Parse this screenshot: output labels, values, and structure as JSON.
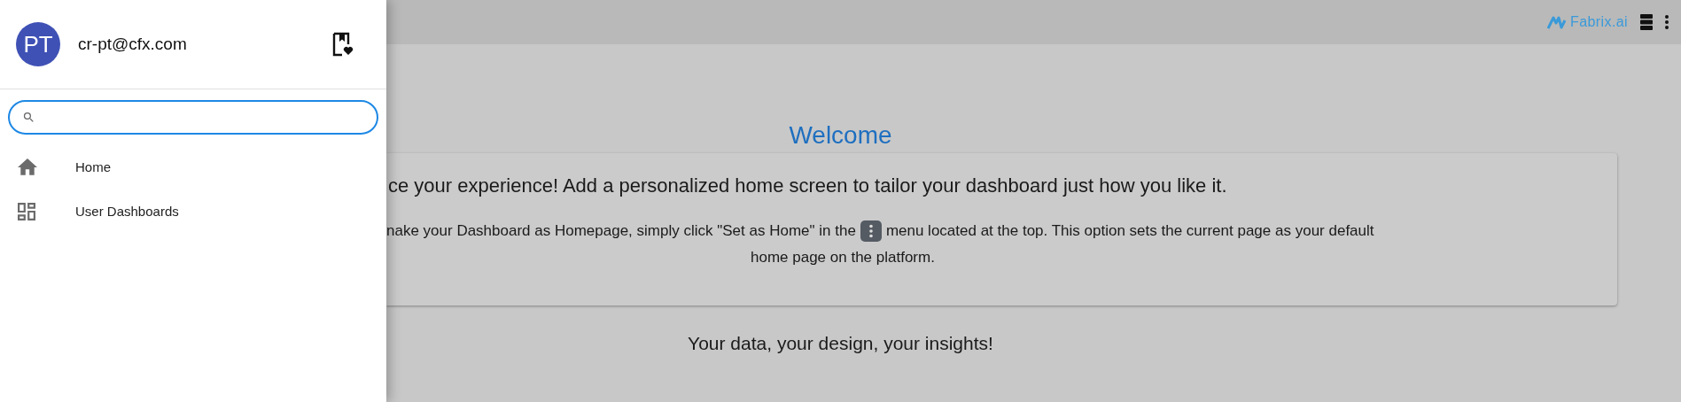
{
  "topbar": {
    "brand": "Fabrix.ai"
  },
  "drawer": {
    "avatar_initials": "PT",
    "email": "cr-pt@cfx.com",
    "search": {
      "focused": true
    },
    "items": [
      {
        "kind": "home",
        "label": "Home"
      },
      {
        "kind": "dashboards",
        "label": "User Dashboards"
      }
    ]
  },
  "main": {
    "title": "Welcome",
    "card": {
      "headline": "ce your experience! Add a personalized home screen to tailor your dashboard just how you like it.",
      "hint_before": "nake your Dashboard as Homepage, simply click \"Set as Home\" in the",
      "hint_after": "menu located at the top. This option sets the current page as your default",
      "hint_last": "home page on the platform."
    },
    "tagline": "Your data, your design, your insights!"
  }
}
